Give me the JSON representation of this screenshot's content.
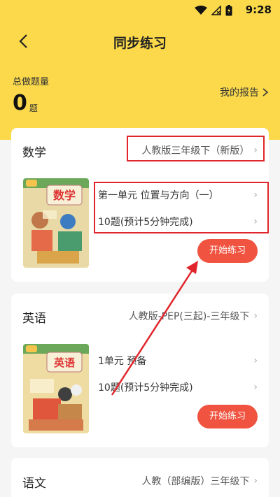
{
  "status": {
    "time": "9:28"
  },
  "header": {
    "title": "同步练习"
  },
  "summary": {
    "label": "总做题量",
    "count": "0",
    "unit": "题",
    "report": "我的报告"
  },
  "cards": [
    {
      "subject": "数学",
      "edition": "人教版三年级下（新版）",
      "book_title": "数学",
      "unit": "第一单元 位置与方向（一）",
      "questions": "10题(预计5分钟完成)",
      "button": "开始练习"
    },
    {
      "subject": "英语",
      "edition": "人教版-PEP(三起)-三年级下",
      "book_title": "英语",
      "unit": "1单元 预备",
      "questions": "10题(预计5分钟完成)",
      "button": "开始练习"
    },
    {
      "subject": "语文",
      "edition": "人教（部编版）三年级下"
    }
  ],
  "colors": {
    "header_yellow": "#fbd94b",
    "button_red": "#f0533f",
    "annotation_red": "#e0262c"
  }
}
